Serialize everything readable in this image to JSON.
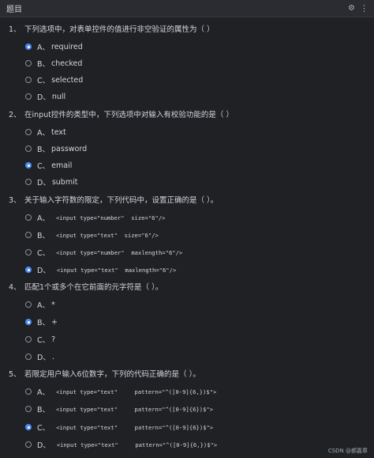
{
  "header": {
    "title": "题目"
  },
  "questions": [
    {
      "number": "1、",
      "text": "下列选项中，对表单控件的值进行非空验证的属性为（   ）",
      "options": [
        {
          "letter": "A、",
          "text": "required",
          "checked": true
        },
        {
          "letter": "B、",
          "text": "checked",
          "checked": false
        },
        {
          "letter": "C、",
          "text": "selected",
          "checked": false
        },
        {
          "letter": "D、",
          "text": "null",
          "checked": false
        }
      ]
    },
    {
      "number": "2、",
      "text": "在input控件的类型中，下列选项中对输入有校验功能的是（   ）",
      "options": [
        {
          "letter": "A、",
          "text": "text",
          "checked": false
        },
        {
          "letter": "B、",
          "text": "password",
          "checked": false
        },
        {
          "letter": "C、",
          "text": "email",
          "checked": true
        },
        {
          "letter": "D、",
          "text": "submit",
          "checked": false
        }
      ]
    },
    {
      "number": "3、",
      "text": "关于输入字符数的限定，下列代码中，设置正确的是（   ）。",
      "options": [
        {
          "letter": "A、",
          "text": "<input type=\"number\"  size=\"6\"/>",
          "checked": false
        },
        {
          "letter": "B、",
          "text": "<input type=\"text\"  size=\"6\"/>",
          "checked": false
        },
        {
          "letter": "C、",
          "text": "<input type=\"number\"  maxlength=\"6\"/>",
          "checked": false
        },
        {
          "letter": "D、",
          "text": "<input type=\"text\"  maxlength=\"6\"/>",
          "checked": true
        }
      ]
    },
    {
      "number": "4、",
      "text": "匹配1个或多个在它前面的元字符是（   ）。",
      "options": [
        {
          "letter": "A、",
          "text": "*",
          "checked": false
        },
        {
          "letter": "B、",
          "text": "+",
          "checked": true
        },
        {
          "letter": "C、",
          "text": "?",
          "checked": false
        },
        {
          "letter": "D、",
          "text": ".",
          "checked": false
        }
      ]
    },
    {
      "number": "5、",
      "text": "若限定用户输入6位数字，下列的代码正确的是（   ）。",
      "options": [
        {
          "letter": "A、",
          "text": "<input type=\"text\"     pattern=\"^([0-9]{6,})$\">",
          "checked": false
        },
        {
          "letter": "B、",
          "text": "<input type=\"text\"     pattern=\"^([0-9]{6})$\">",
          "checked": false
        },
        {
          "letter": "C、",
          "text": "<input type=\"text\"     pattern=\"^([0-9]{6})$\">",
          "checked": true
        },
        {
          "letter": "D、",
          "text": "<input type=\"text\"     pattern=\"^([0-9]{6,})$\">",
          "checked": false
        }
      ]
    }
  ],
  "watermark": "CSDN @郝嘉章",
  "colors": {
    "background": "#1f2125",
    "accent": "#4c8df6",
    "text": "#d3d6db"
  },
  "icons": [
    "gear-icon",
    "menu-icon"
  ]
}
